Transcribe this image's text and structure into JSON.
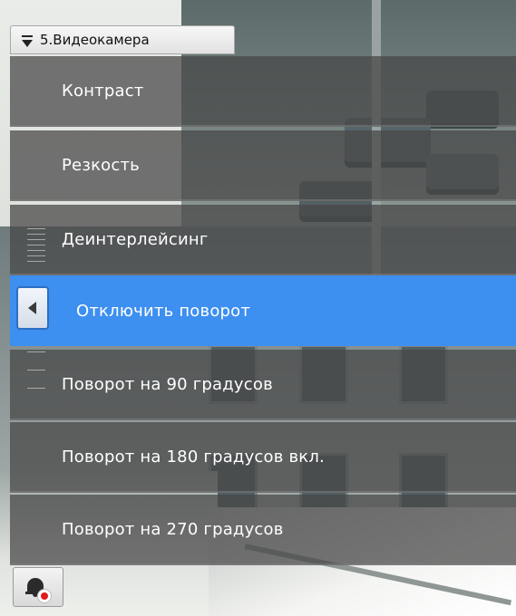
{
  "camera_tab": {
    "label": "5.Видеокамера",
    "icon": "dropdown-triangle-icon"
  },
  "menu": {
    "items": [
      {
        "label": "Контраст",
        "selected": false
      },
      {
        "label": "Резкость",
        "selected": false
      },
      {
        "label": "Деинтерлейсинг",
        "selected": false
      },
      {
        "label": "Отключить поворот",
        "selected": true
      },
      {
        "label": "Поворот на 90 градусов",
        "selected": false
      },
      {
        "label": "Поворот на 180 градусов вкл.",
        "selected": false
      },
      {
        "label": "Поворот на 270 градусов",
        "selected": false
      }
    ],
    "back_icon": "chevron-left-icon",
    "highlight_color": "#3d8ff0"
  },
  "alarm_button": {
    "icon": "bell-icon",
    "indicator": "record-dot-icon",
    "indicator_color": "#e01c1c"
  }
}
